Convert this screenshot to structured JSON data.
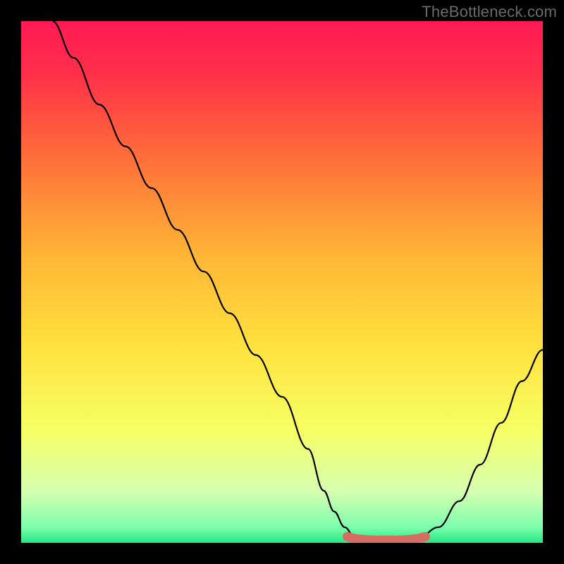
{
  "watermark": "TheBottleneck.com",
  "colors": {
    "background": "#000000",
    "gradient_stops": [
      {
        "offset": 0.0,
        "color": "#ff1a53"
      },
      {
        "offset": 0.1,
        "color": "#ff2f4a"
      },
      {
        "offset": 0.25,
        "color": "#ff6a3a"
      },
      {
        "offset": 0.45,
        "color": "#ffb636"
      },
      {
        "offset": 0.62,
        "color": "#ffe13e"
      },
      {
        "offset": 0.78,
        "color": "#f7ff63"
      },
      {
        "offset": 0.9,
        "color": "#d7ffb0"
      },
      {
        "offset": 0.97,
        "color": "#7dffad"
      },
      {
        "offset": 1.0,
        "color": "#23e884"
      }
    ],
    "curve": "#000000",
    "marker": "#d76c62"
  },
  "chart_data": {
    "type": "line",
    "title": "",
    "xlabel": "",
    "ylabel": "",
    "xlim": [
      0,
      100
    ],
    "ylim": [
      0,
      100
    ],
    "series": [
      {
        "name": "bottleneck-curve",
        "x": [
          6,
          10,
          15,
          20,
          25,
          30,
          35,
          40,
          45,
          50,
          55,
          58,
          60,
          62,
          64,
          68,
          72,
          76,
          80,
          84,
          88,
          92,
          96,
          100
        ],
        "y": [
          100,
          93,
          84,
          76,
          68,
          60,
          52,
          44,
          36,
          28,
          18,
          10,
          6,
          3,
          1,
          0.5,
          0.5,
          0.8,
          3,
          8,
          15,
          23,
          31,
          37
        ]
      }
    ],
    "markers": {
      "name": "optimal-range",
      "x": [
        62.5,
        64,
        66,
        68,
        70,
        72,
        74,
        76,
        77.5
      ],
      "y": [
        1.2,
        0.8,
        0.6,
        0.5,
        0.5,
        0.5,
        0.6,
        0.8,
        1.2
      ]
    }
  }
}
